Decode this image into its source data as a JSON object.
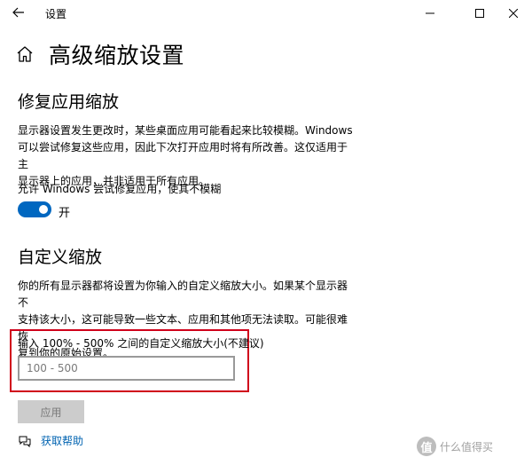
{
  "window": {
    "title": "设置",
    "controls": [
      "minimize",
      "maximize",
      "close"
    ]
  },
  "page": {
    "title": "高级缩放设置"
  },
  "fix_apps": {
    "heading": "修复应用缩放",
    "desc_lines": [
      "显示器设置发生更改时，某些桌面应用可能看起来比较模糊。Windows",
      "可以尝试修复这些应用，因此下次打开应用时将有所改善。这仅适用于主",
      "显示器上的应用，并非适用于所有应用。"
    ],
    "toggle_label": "允许 Windows 尝试修复应用，使其不模糊",
    "toggle_state": "开",
    "toggle_on": true,
    "accent_color": "#0067c0"
  },
  "custom_scaling": {
    "heading": "自定义缩放",
    "desc_lines": [
      "你的所有显示器都将设置为你输入的自定义缩放大小。如果某个显示器不",
      "支持该大小，这可能导致一些文本、应用和其他项无法读取。可能很难恢",
      "复到你的原始设置。"
    ],
    "input_label": "输入 100% - 500% 之间的自定义缩放大小(不建议)",
    "input_placeholder": "100 - 500",
    "input_value": "",
    "highlight_color": "#d0021b",
    "apply_label": "应用",
    "apply_enabled": false
  },
  "help": {
    "label": "获取帮助",
    "icon": "chat-bubbles-icon",
    "link_color": "#0063b1"
  },
  "watermark": {
    "logo_char": "值",
    "text": "什么值得买"
  }
}
